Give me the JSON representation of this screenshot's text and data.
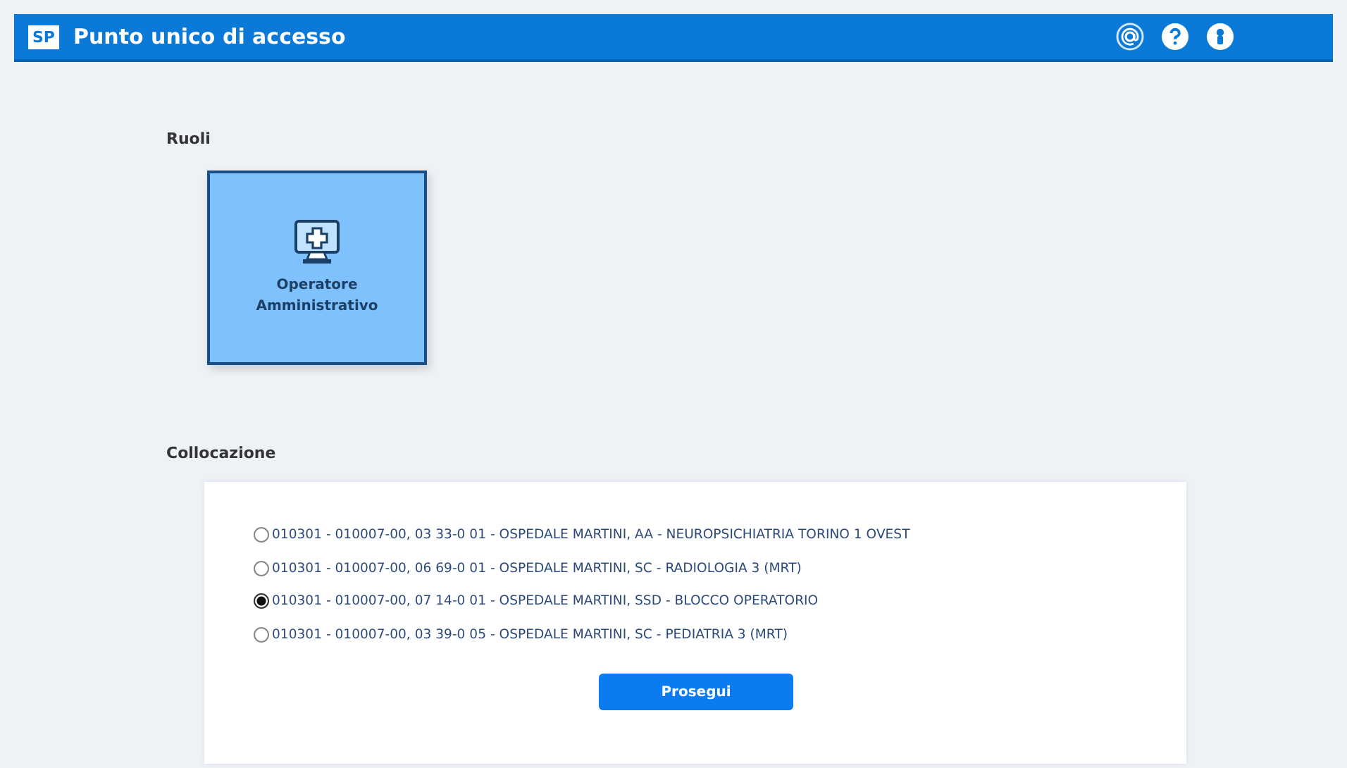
{
  "header": {
    "logo": "SP",
    "title": "Punto unico di accesso"
  },
  "roles": {
    "heading": "Ruoli",
    "items": [
      {
        "label": "Operatore Amministrativo",
        "selected": true
      }
    ]
  },
  "placement": {
    "heading": "Collocazione",
    "options": [
      {
        "label": "010301 - 010007-00, 03 33-0 01 - OSPEDALE MARTINI, AA - NEUROPSICHIATRIA TORINO 1 OVEST",
        "selected": false
      },
      {
        "label": "010301 - 010007-00, 06 69-0 01 - OSPEDALE MARTINI, SC - RADIOLOGIA 3 (MRT)",
        "selected": false
      },
      {
        "label": "010301 - 010007-00, 07 14-0 01 - OSPEDALE MARTINI, SSD - BLOCCO OPERATORIO",
        "selected": true
      },
      {
        "label": "010301 - 010007-00, 03 39-0 05 - OSPEDALE MARTINI, SC - PEDIATRIA 3 (MRT)",
        "selected": false
      }
    ],
    "button": "Prosegui"
  }
}
